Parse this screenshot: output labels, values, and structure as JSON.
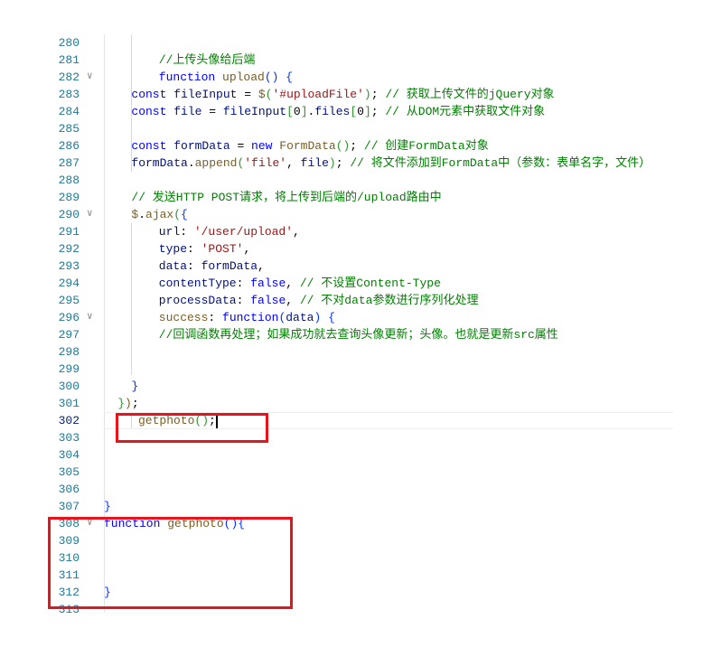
{
  "editor": {
    "current_line": 302,
    "colors": {
      "keyword": "#0000ff",
      "function": "#795e26",
      "variable": "#001080",
      "string": "#a31515",
      "comment": "#008000",
      "line_number": "#237893",
      "highlight_box": "#e8141c"
    },
    "lines": [
      {
        "n": "280",
        "indent": 8,
        "tokens": []
      },
      {
        "n": "281",
        "indent": 8,
        "tokens": [
          [
            "cm",
            "//上传头像给后端"
          ]
        ]
      },
      {
        "n": "282",
        "indent": 8,
        "fold": true,
        "tokens": [
          [
            "kw",
            "function"
          ],
          [
            "pn",
            " "
          ],
          [
            "fn",
            "upload"
          ],
          [
            "br",
            "()"
          ],
          [
            "pn",
            " "
          ],
          [
            "br",
            "{"
          ]
        ]
      },
      {
        "n": "283",
        "indent": 4,
        "tokens": [
          [
            "kw",
            "const"
          ],
          [
            "pn",
            " "
          ],
          [
            "var",
            "fileInput"
          ],
          [
            "pn",
            " = "
          ],
          [
            "fn",
            "$"
          ],
          [
            "br2",
            "("
          ],
          [
            "str",
            "'#uploadFile'"
          ],
          [
            "br2",
            ")"
          ],
          [
            "pn",
            "; "
          ],
          [
            "cm",
            "// 获取上传文件的jQuery对象"
          ]
        ]
      },
      {
        "n": "284",
        "indent": 4,
        "tokens": [
          [
            "kw",
            "const"
          ],
          [
            "pn",
            " "
          ],
          [
            "var",
            "file"
          ],
          [
            "pn",
            " = "
          ],
          [
            "var",
            "fileInput"
          ],
          [
            "br2",
            "["
          ],
          [
            "pn",
            "0"
          ],
          [
            "br2",
            "]"
          ],
          [
            "pn",
            "."
          ],
          [
            "var",
            "files"
          ],
          [
            "br2",
            "["
          ],
          [
            "pn",
            "0"
          ],
          [
            "br2",
            "]"
          ],
          [
            "pn",
            "; "
          ],
          [
            "cm",
            "// 从DOM元素中获取文件对象"
          ]
        ]
      },
      {
        "n": "285",
        "indent": 0,
        "tokens": []
      },
      {
        "n": "286",
        "indent": 4,
        "tokens": [
          [
            "kw",
            "const"
          ],
          [
            "pn",
            " "
          ],
          [
            "var",
            "formData"
          ],
          [
            "pn",
            " = "
          ],
          [
            "kw",
            "new"
          ],
          [
            "pn",
            " "
          ],
          [
            "fn",
            "FormData"
          ],
          [
            "br2",
            "()"
          ],
          [
            "pn",
            "; "
          ],
          [
            "cm",
            "// 创建FormData对象"
          ]
        ]
      },
      {
        "n": "287",
        "indent": 4,
        "tokens": [
          [
            "var",
            "formData"
          ],
          [
            "pn",
            "."
          ],
          [
            "fn",
            "append"
          ],
          [
            "br2",
            "("
          ],
          [
            "str",
            "'file'"
          ],
          [
            "pn",
            ", "
          ],
          [
            "var",
            "file"
          ],
          [
            "br2",
            ")"
          ],
          [
            "pn",
            "; "
          ],
          [
            "cm",
            "// 将文件添加到FormData中（参数：表单名字，文件）"
          ]
        ]
      },
      {
        "n": "288",
        "indent": 0,
        "tokens": []
      },
      {
        "n": "289",
        "indent": 4,
        "tokens": [
          [
            "cm",
            "// 发送HTTP POST请求，将上传到后端的/upload路由中"
          ]
        ]
      },
      {
        "n": "290",
        "indent": 4,
        "fold": true,
        "tokens": [
          [
            "fn",
            "$"
          ],
          [
            "pn",
            "."
          ],
          [
            "fn",
            "ajax"
          ],
          [
            "br2",
            "("
          ],
          [
            "br",
            "{"
          ]
        ]
      },
      {
        "n": "291",
        "indent": 8,
        "tokens": [
          [
            "var",
            "url"
          ],
          [
            "pn",
            ": "
          ],
          [
            "str",
            "'/user/upload'"
          ],
          [
            "pn",
            ","
          ]
        ]
      },
      {
        "n": "292",
        "indent": 8,
        "tokens": [
          [
            "var",
            "type"
          ],
          [
            "pn",
            ": "
          ],
          [
            "str",
            "'POST'"
          ],
          [
            "pn",
            ","
          ]
        ]
      },
      {
        "n": "293",
        "indent": 8,
        "tokens": [
          [
            "var",
            "data"
          ],
          [
            "pn",
            ": "
          ],
          [
            "var",
            "formData"
          ],
          [
            "pn",
            ","
          ]
        ]
      },
      {
        "n": "294",
        "indent": 8,
        "tokens": [
          [
            "var",
            "contentType"
          ],
          [
            "pn",
            ": "
          ],
          [
            "kw",
            "false"
          ],
          [
            "pn",
            ", "
          ],
          [
            "cm",
            "// 不设置Content-Type"
          ]
        ]
      },
      {
        "n": "295",
        "indent": 8,
        "tokens": [
          [
            "var",
            "processData"
          ],
          [
            "pn",
            ": "
          ],
          [
            "kw",
            "false"
          ],
          [
            "pn",
            ", "
          ],
          [
            "cm",
            "// 不对data参数进行序列化处理"
          ]
        ]
      },
      {
        "n": "296",
        "indent": 8,
        "fold": true,
        "tokens": [
          [
            "fn",
            "success"
          ],
          [
            "pn",
            ": "
          ],
          [
            "kw",
            "function"
          ],
          [
            "br",
            "("
          ],
          [
            "var",
            "data"
          ],
          [
            "br",
            ")"
          ],
          [
            "pn",
            " "
          ],
          [
            "br",
            "{"
          ]
        ]
      },
      {
        "n": "297",
        "indent": 8,
        "tokens": [
          [
            "cm",
            "//回调函数再处理；如果成功就去查询头像更新；头像。也就是更新src属性"
          ]
        ]
      },
      {
        "n": "298",
        "indent": 0,
        "tokens": []
      },
      {
        "n": "299",
        "indent": 0,
        "tokens": []
      },
      {
        "n": "300",
        "indent": 4,
        "tokens": [
          [
            "br",
            "}"
          ]
        ]
      },
      {
        "n": "301",
        "indent": 2,
        "tokens": [
          [
            "br2",
            "}"
          ],
          [
            "fn",
            ")"
          ],
          [
            "pn",
            ";"
          ]
        ]
      },
      {
        "n": "302",
        "indent": 5,
        "tokens": [
          [
            "fn",
            "getphoto"
          ],
          [
            "br2",
            "()"
          ],
          [
            "pn",
            ";"
          ]
        ]
      },
      {
        "n": "303",
        "indent": 0,
        "tokens": []
      },
      {
        "n": "304",
        "indent": 0,
        "tokens": []
      },
      {
        "n": "305",
        "indent": 0,
        "tokens": []
      },
      {
        "n": "306",
        "indent": 0,
        "tokens": []
      },
      {
        "n": "307",
        "indent": 0,
        "tokens": [
          [
            "br",
            "}"
          ]
        ]
      },
      {
        "n": "308",
        "indent": 0,
        "fold": true,
        "tokens": [
          [
            "kw",
            "function"
          ],
          [
            "pn",
            " "
          ],
          [
            "fn",
            "getphoto"
          ],
          [
            "br",
            "()"
          ],
          [
            "br",
            "{"
          ]
        ]
      },
      {
        "n": "309",
        "indent": 0,
        "tokens": []
      },
      {
        "n": "310",
        "indent": 0,
        "tokens": []
      },
      {
        "n": "311",
        "indent": 0,
        "tokens": []
      },
      {
        "n": "312",
        "indent": 0,
        "tokens": [
          [
            "br",
            "}"
          ]
        ]
      },
      {
        "n": "313",
        "indent": 0,
        "tokens": []
      }
    ]
  }
}
